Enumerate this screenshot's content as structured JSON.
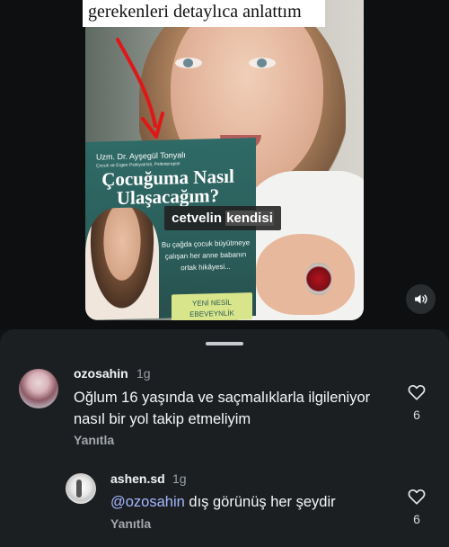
{
  "video": {
    "caption_top": "gerekenleri detaylıca anlattım",
    "sticker_prefix": "cetvelin ",
    "sticker_highlight": "kendisi",
    "book": {
      "author": "Uzm. Dr. Ayşegül Tonyalı",
      "author_subtitle": "Çocuk ve Ergen Psikiyatristi, Psikoterapist",
      "title": "Çocuğuma Nasıl Ulaşacağım?",
      "blurb": "Bu çağda çocuk büyütmeye çalışan her anne babanın ortak hikâyesi...",
      "band": "YENİ NESİL EBEVEYNLİK"
    },
    "sound_icon": "speaker-icon"
  },
  "comments": [
    {
      "username": "ozosahin",
      "time": "1g",
      "text": "Oğlum 16 yaşında ve saçmalıklarla ilgileniyor nasıl bir yol takip etmeliyim",
      "reply_label": "Yanıtla",
      "likes": "6"
    },
    {
      "username": "ashen.sd",
      "time": "1g",
      "mention": "@ozosahin",
      "text": " dış görünüş her şeydir",
      "reply_label": "Yanıtla",
      "likes": "6"
    }
  ],
  "colors": {
    "sheet_bg": "#1c1f22",
    "page_bg": "#101214",
    "mention": "#a4b7ff",
    "muted": "#a2a7ad"
  }
}
